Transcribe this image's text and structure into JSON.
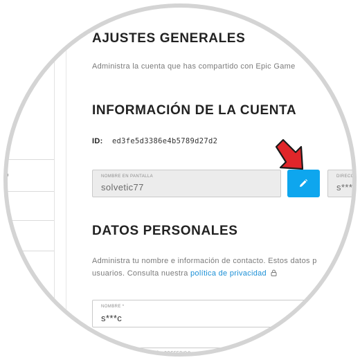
{
  "general": {
    "title": "AJUSTES GENERALES",
    "description": "Administra la cuenta que has compartido con Epic Game"
  },
  "account": {
    "title": "INFORMACIÓN DE LA CUENTA",
    "id_label": "ID:",
    "id_value": "ed3fe5d3386e4b5789d27d2",
    "display_name_label": "NOMBRE EN PANTALLA",
    "display_name_value": "solvetic77",
    "email_label": "DIRECCIÓ",
    "email_value": "s***"
  },
  "personal": {
    "title": "DATOS PERSONALES",
    "description_line1": "Administra tu nombre e información de contacto. Estos datos p",
    "description_line2_prefix": "usuarios. Consulta nuestra ",
    "privacy_link": "política de privacidad",
    "name_label": "NOMBRE *",
    "name_value": "s***c",
    "lang_label": "IDIOMA DE COMUNICACIÓN PREFERIDO"
  },
  "sidebar": {
    "fragment": "o"
  },
  "colors": {
    "accent": "#0ea6ee",
    "arrow": "#e0262a",
    "link": "#1a8fd6"
  },
  "icons": [
    "pencil-icon",
    "lock-icon",
    "arrow-annotation-icon"
  ]
}
